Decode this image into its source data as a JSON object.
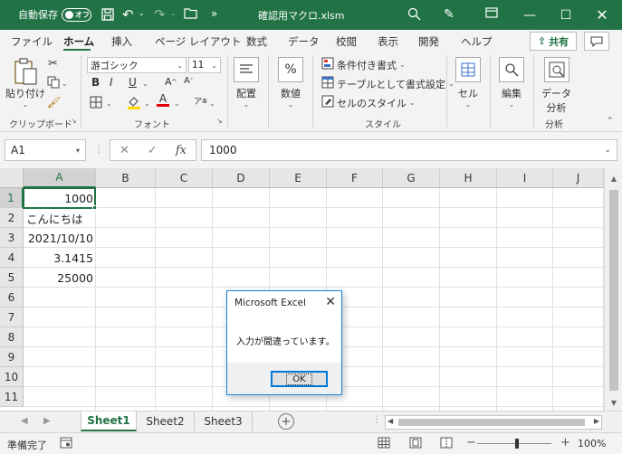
{
  "titlebar": {
    "autosave_label": "自動保存",
    "autosave_state": "オフ",
    "file_title": "確認用マクロ.xlsm",
    "accent": "#217346"
  },
  "ribbon_tabs": [
    "ファイル",
    "ホーム",
    "挿入",
    "ページ レイアウト",
    "数式",
    "データ",
    "校閲",
    "表示",
    "開発",
    "ヘルプ"
  ],
  "active_tab": "ホーム",
  "share_label": "共有",
  "ribbon": {
    "paste_label": "貼り付け",
    "clipboard_label": "クリップボード",
    "font_name": "游ゴシック",
    "font_size": "11",
    "bold": "B",
    "italic": "I",
    "underline": "U",
    "font_label": "フォント",
    "alignment_label": "配置",
    "number_label": "数値",
    "conditional_format": "条件付き書式",
    "format_as_table": "テーブルとして書式設定",
    "cell_styles": "セルのスタイル",
    "styles_label": "スタイル",
    "cells_label": "セル",
    "editing_label": "編集",
    "data_analysis_line1": "データ",
    "data_analysis_line2": "分析",
    "analysis_label": "分析"
  },
  "formula_bar": {
    "name_box": "A1",
    "fx": "fx",
    "value": "1000"
  },
  "grid": {
    "columns": [
      "A",
      "B",
      "C",
      "D",
      "E",
      "F",
      "G",
      "H",
      "I",
      "J"
    ],
    "rows": [
      "1",
      "2",
      "3",
      "4",
      "5",
      "6",
      "7",
      "8",
      "9",
      "10",
      "11"
    ],
    "cells": {
      "A1": "1000",
      "A2": "こんにちは",
      "A3": "2021/10/10",
      "A4": "3.1415",
      "A5": "25000"
    }
  },
  "sheets": [
    "Sheet1",
    "Sheet2",
    "Sheet3"
  ],
  "active_sheet": "Sheet1",
  "status": {
    "text": "準備完了",
    "zoom": "100%"
  },
  "dialog": {
    "title": "Microsoft Excel",
    "message": "入力が間違っています。",
    "ok_label": "OK"
  }
}
